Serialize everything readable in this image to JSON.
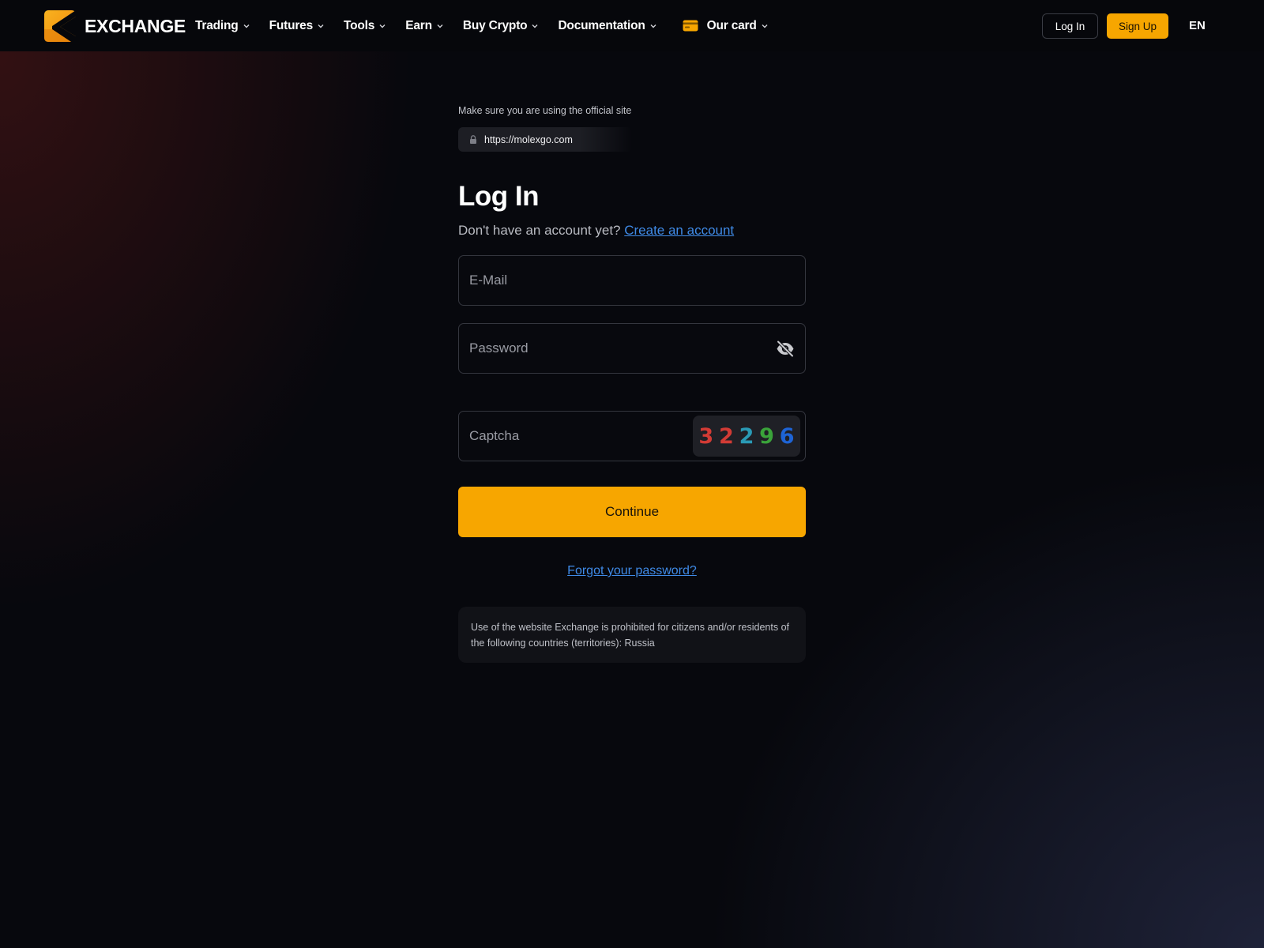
{
  "header": {
    "logo_text": "EXCHANGE",
    "nav": [
      {
        "label": "Trading"
      },
      {
        "label": "Futures"
      },
      {
        "label": "Tools"
      },
      {
        "label": "Earn"
      },
      {
        "label": "Buy Crypto"
      },
      {
        "label": "Documentation"
      },
      {
        "label": "Our card"
      }
    ],
    "login_label": "Log In",
    "signup_label": "Sign Up",
    "language": "EN"
  },
  "main": {
    "official_note": "Make sure you are using the official site",
    "official_url": "https://molexgo.com",
    "title": "Log In",
    "no_account_text": "Don't have an account yet?",
    "create_account_link": "Create an account",
    "email_placeholder": "E-Mail",
    "password_placeholder": "Password",
    "captcha_placeholder": "Captcha",
    "captcha_digits": [
      "3",
      "2",
      "2",
      "9",
      "6"
    ],
    "continue_label": "Continue",
    "forgot_link": "Forgot your password?",
    "notice": "Use of the website Exchange is prohibited for citizens and/or residents of the following countries (territories): Russia"
  },
  "colors": {
    "accent": "#f7a600",
    "link": "#3f8ae6",
    "background": "#07080d",
    "captcha_colors": [
      "#d23b35",
      "#d23b35",
      "#2a9ab5",
      "#3aa33a",
      "#1e64d6"
    ]
  },
  "icons": {
    "logo": "exchange-logo",
    "dropdown": "chevron-down-icon",
    "card": "card-icon",
    "lock": "lock-icon",
    "password_toggle": "eye-slash-icon"
  }
}
